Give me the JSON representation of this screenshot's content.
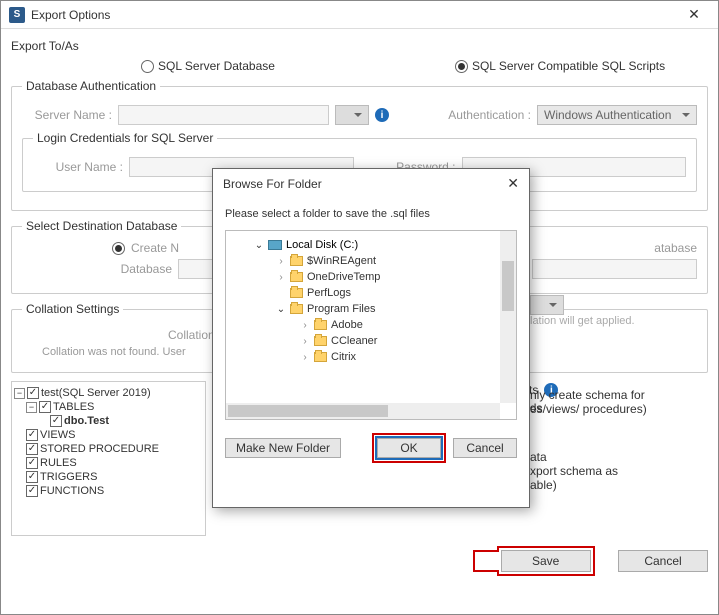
{
  "window": {
    "title": "Export Options",
    "close": "✕"
  },
  "exportTo": {
    "heading": "Export To/As",
    "opt1": "SQL Server Database",
    "opt2": "SQL Server Compatible SQL Scripts"
  },
  "dbAuth": {
    "legend": "Database Authentication",
    "serverLabel": "Server Name :",
    "authLabel": "Authentication :",
    "authValue": "Windows Authentication"
  },
  "login": {
    "legend": "Login Credentials for SQL Server",
    "userLabel": "User Name :",
    "passLabel": "Password :"
  },
  "dest": {
    "legend": "Select Destination Database",
    "createNew": "Create N",
    "existing": "atabase",
    "dbNameLabel": "Database"
  },
  "collation": {
    "legend": "Collation Settings",
    "label": "Collation",
    "note": "Collation was not found. User",
    "noteRight": "lation will get applied."
  },
  "tree": {
    "root": "test(SQL Server 2019)",
    "items": [
      "TABLES",
      "dbo.Test",
      "VIEWS",
      "STORED PROCEDURE",
      "RULES",
      "TRIGGERS",
      "FUNCTIONS"
    ]
  },
  "schema": {
    "peek1": "nly create schema for",
    "peek2": "es/views/ procedures)",
    "data_label": "ata",
    "peek3": "xport schema as",
    "peek4": "able)"
  },
  "deleted": {
    "objects": "Export Deleted Objects",
    "records": "Export Deleted Records"
  },
  "buttons": {
    "save": "Save",
    "cancel": "Cancel"
  },
  "modal": {
    "title": "Browse For Folder",
    "close": "✕",
    "message": "Please select a folder to save the .sql files",
    "disk": "Local Disk (C:)",
    "folders": [
      "$WinREAgent",
      "OneDriveTemp",
      "PerfLogs",
      "Program Files",
      "Adobe",
      "CCleaner",
      "Citrix"
    ],
    "makeNew": "Make New Folder",
    "ok": "OK",
    "cancel": "Cancel"
  }
}
